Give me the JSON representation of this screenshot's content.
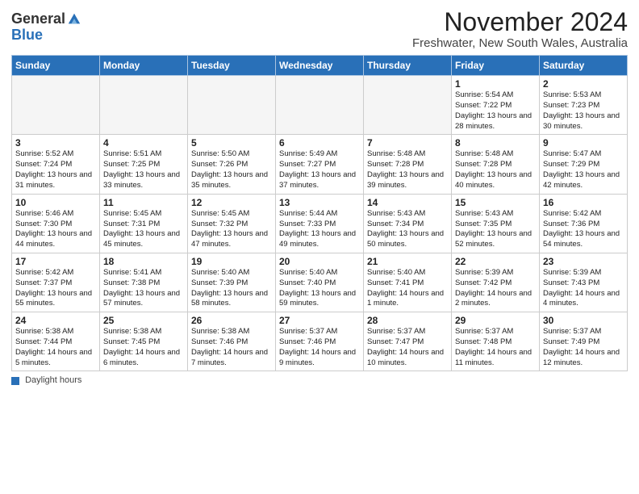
{
  "header": {
    "logo_general": "General",
    "logo_blue": "Blue",
    "title": "November 2024",
    "subtitle": "Freshwater, New South Wales, Australia"
  },
  "columns": [
    "Sunday",
    "Monday",
    "Tuesday",
    "Wednesday",
    "Thursday",
    "Friday",
    "Saturday"
  ],
  "weeks": [
    [
      {
        "day": "",
        "info": ""
      },
      {
        "day": "",
        "info": ""
      },
      {
        "day": "",
        "info": ""
      },
      {
        "day": "",
        "info": ""
      },
      {
        "day": "",
        "info": ""
      },
      {
        "day": "1",
        "info": "Sunrise: 5:54 AM\nSunset: 7:22 PM\nDaylight: 13 hours and 28 minutes."
      },
      {
        "day": "2",
        "info": "Sunrise: 5:53 AM\nSunset: 7:23 PM\nDaylight: 13 hours and 30 minutes."
      }
    ],
    [
      {
        "day": "3",
        "info": "Sunrise: 5:52 AM\nSunset: 7:24 PM\nDaylight: 13 hours and 31 minutes."
      },
      {
        "day": "4",
        "info": "Sunrise: 5:51 AM\nSunset: 7:25 PM\nDaylight: 13 hours and 33 minutes."
      },
      {
        "day": "5",
        "info": "Sunrise: 5:50 AM\nSunset: 7:26 PM\nDaylight: 13 hours and 35 minutes."
      },
      {
        "day": "6",
        "info": "Sunrise: 5:49 AM\nSunset: 7:27 PM\nDaylight: 13 hours and 37 minutes."
      },
      {
        "day": "7",
        "info": "Sunrise: 5:48 AM\nSunset: 7:28 PM\nDaylight: 13 hours and 39 minutes."
      },
      {
        "day": "8",
        "info": "Sunrise: 5:48 AM\nSunset: 7:28 PM\nDaylight: 13 hours and 40 minutes."
      },
      {
        "day": "9",
        "info": "Sunrise: 5:47 AM\nSunset: 7:29 PM\nDaylight: 13 hours and 42 minutes."
      }
    ],
    [
      {
        "day": "10",
        "info": "Sunrise: 5:46 AM\nSunset: 7:30 PM\nDaylight: 13 hours and 44 minutes."
      },
      {
        "day": "11",
        "info": "Sunrise: 5:45 AM\nSunset: 7:31 PM\nDaylight: 13 hours and 45 minutes."
      },
      {
        "day": "12",
        "info": "Sunrise: 5:45 AM\nSunset: 7:32 PM\nDaylight: 13 hours and 47 minutes."
      },
      {
        "day": "13",
        "info": "Sunrise: 5:44 AM\nSunset: 7:33 PM\nDaylight: 13 hours and 49 minutes."
      },
      {
        "day": "14",
        "info": "Sunrise: 5:43 AM\nSunset: 7:34 PM\nDaylight: 13 hours and 50 minutes."
      },
      {
        "day": "15",
        "info": "Sunrise: 5:43 AM\nSunset: 7:35 PM\nDaylight: 13 hours and 52 minutes."
      },
      {
        "day": "16",
        "info": "Sunrise: 5:42 AM\nSunset: 7:36 PM\nDaylight: 13 hours and 54 minutes."
      }
    ],
    [
      {
        "day": "17",
        "info": "Sunrise: 5:42 AM\nSunset: 7:37 PM\nDaylight: 13 hours and 55 minutes."
      },
      {
        "day": "18",
        "info": "Sunrise: 5:41 AM\nSunset: 7:38 PM\nDaylight: 13 hours and 57 minutes."
      },
      {
        "day": "19",
        "info": "Sunrise: 5:40 AM\nSunset: 7:39 PM\nDaylight: 13 hours and 58 minutes."
      },
      {
        "day": "20",
        "info": "Sunrise: 5:40 AM\nSunset: 7:40 PM\nDaylight: 13 hours and 59 minutes."
      },
      {
        "day": "21",
        "info": "Sunrise: 5:40 AM\nSunset: 7:41 PM\nDaylight: 14 hours and 1 minute."
      },
      {
        "day": "22",
        "info": "Sunrise: 5:39 AM\nSunset: 7:42 PM\nDaylight: 14 hours and 2 minutes."
      },
      {
        "day": "23",
        "info": "Sunrise: 5:39 AM\nSunset: 7:43 PM\nDaylight: 14 hours and 4 minutes."
      }
    ],
    [
      {
        "day": "24",
        "info": "Sunrise: 5:38 AM\nSunset: 7:44 PM\nDaylight: 14 hours and 5 minutes."
      },
      {
        "day": "25",
        "info": "Sunrise: 5:38 AM\nSunset: 7:45 PM\nDaylight: 14 hours and 6 minutes."
      },
      {
        "day": "26",
        "info": "Sunrise: 5:38 AM\nSunset: 7:46 PM\nDaylight: 14 hours and 7 minutes."
      },
      {
        "day": "27",
        "info": "Sunrise: 5:37 AM\nSunset: 7:46 PM\nDaylight: 14 hours and 9 minutes."
      },
      {
        "day": "28",
        "info": "Sunrise: 5:37 AM\nSunset: 7:47 PM\nDaylight: 14 hours and 10 minutes."
      },
      {
        "day": "29",
        "info": "Sunrise: 5:37 AM\nSunset: 7:48 PM\nDaylight: 14 hours and 11 minutes."
      },
      {
        "day": "30",
        "info": "Sunrise: 5:37 AM\nSunset: 7:49 PM\nDaylight: 14 hours and 12 minutes."
      }
    ]
  ],
  "legend": {
    "label": "Daylight hours"
  }
}
